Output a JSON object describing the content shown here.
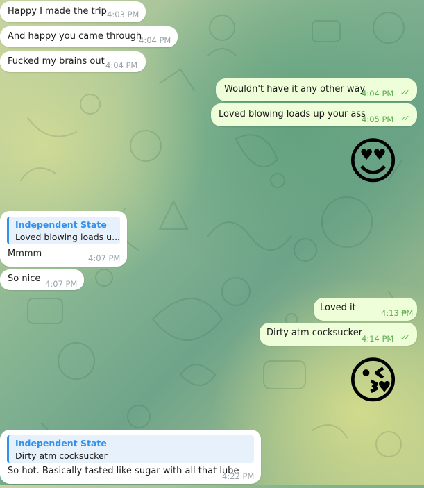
{
  "messages": [
    {
      "text": "Happy I made the trip",
      "time": "4:03 PM"
    },
    {
      "text": "And happy you came through",
      "time": "4:04 PM"
    },
    {
      "text": "Fucked my brains out",
      "time": "4:04 PM"
    },
    {
      "text": "Wouldn't have it any other way",
      "time": "4:04 PM"
    },
    {
      "text": "Loved blowing loads up your ass",
      "time": "4:05 PM"
    },
    {
      "emoji": "😍"
    },
    {
      "reply_name": "Independent State",
      "reply_text": "Loved blowing loads u...",
      "text": "Mmmm",
      "time": "4:07 PM"
    },
    {
      "text": "So nice",
      "time": "4:07 PM"
    },
    {
      "text": "Loved it",
      "time": "4:13 PM"
    },
    {
      "text": "Dirty atm cocksucker",
      "time": "4:14 PM"
    },
    {
      "emoji": "😘"
    },
    {
      "reply_name": "Independent State",
      "reply_text": "Dirty atm cocksucker",
      "text": "So hot. Basically tasted like sugar with all that lube",
      "time": "4:22 PM"
    }
  ],
  "status": {
    "read_ticks": "✓✓"
  },
  "colors": {
    "incoming": "#ffffff",
    "outgoing": "#eefed8",
    "accent": "#3390ec",
    "tick": "#4fae4e"
  }
}
